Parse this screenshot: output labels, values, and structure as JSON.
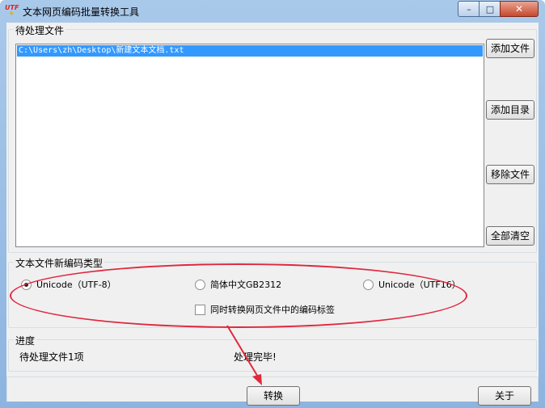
{
  "window": {
    "title": "文本网页编码批量转换工具",
    "icon_name": "utf-app-icon",
    "icon_text": "UTF",
    "controls": {
      "minimize": "–",
      "maximize": "□",
      "close": "✕"
    }
  },
  "files_group": {
    "label": "待处理文件",
    "files": [
      "C:\\Users\\zh\\Desktop\\新建文本文档.txt"
    ],
    "buttons": {
      "add_file": "添加文件",
      "add_dir": "添加目录",
      "remove_file": "移除文件",
      "clear_all": "全部清空"
    }
  },
  "encoding_group": {
    "label": "文本文件新编码类型",
    "options": [
      {
        "label": "Unicode（UTF-8）",
        "checked": true
      },
      {
        "label": "简体中文GB2312",
        "checked": false
      },
      {
        "label": "Unicode（UTF16）",
        "checked": false
      }
    ],
    "convert_tags_label": "同时转换网页文件中的编码标签",
    "convert_tags_checked": false
  },
  "progress_group": {
    "label": "进度",
    "pending_text": "待处理文件1项",
    "status_text": "处理完毕!"
  },
  "bottom": {
    "convert_button": "转换",
    "about_button": "关于"
  },
  "colors": {
    "selection": "#3399ff",
    "annotation": "#e0283e"
  }
}
